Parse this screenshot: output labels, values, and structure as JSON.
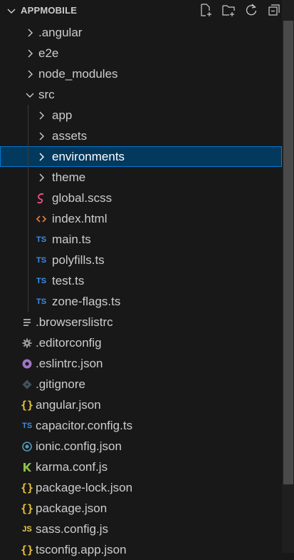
{
  "explorer": {
    "title": "APPMOBILE",
    "actions": [
      "new-file-icon",
      "new-folder-icon",
      "refresh-icon",
      "collapse-all-icon"
    ]
  },
  "tree": {
    "angular": ".angular",
    "e2e": "e2e",
    "node_modules": "node_modules",
    "src": "src",
    "app": "app",
    "assets": "assets",
    "environments": "environments",
    "theme": "theme",
    "global_scss": "global.scss",
    "index_html": "index.html",
    "main_ts": "main.ts",
    "polyfills_ts": "polyfills.ts",
    "test_ts": "test.ts",
    "zone_flags_ts": "zone-flags.ts",
    "browserslistrc": ".browserslistrc",
    "editorconfig": ".editorconfig",
    "eslintrc_json": ".eslintrc.json",
    "gitignore": ".gitignore",
    "angular_json": "angular.json",
    "capacitor_config_ts": "capacitor.config.ts",
    "ionic_config_json": "ionic.config.json",
    "karma_conf_js": "karma.conf.js",
    "package_lock_json": "package-lock.json",
    "package_json": "package.json",
    "sass_config_js": "sass.config.js",
    "tsconfig_app_json": "tsconfig.app.json"
  },
  "icon_text": {
    "ts": "TS",
    "js": "JS",
    "json": "{}"
  },
  "colors": {
    "background": "#181818",
    "selection": "#04395e",
    "selection_border": "#0078d4",
    "ts_icon": "#3b8eea",
    "json_icon": "#e8c23a",
    "html_icon": "#e37933",
    "sass_icon": "#f55385",
    "eslint_icon": "#a074c4",
    "ionic_icon": "#519aba",
    "karma_icon": "#8dc149",
    "js_icon": "#e8d44d"
  }
}
